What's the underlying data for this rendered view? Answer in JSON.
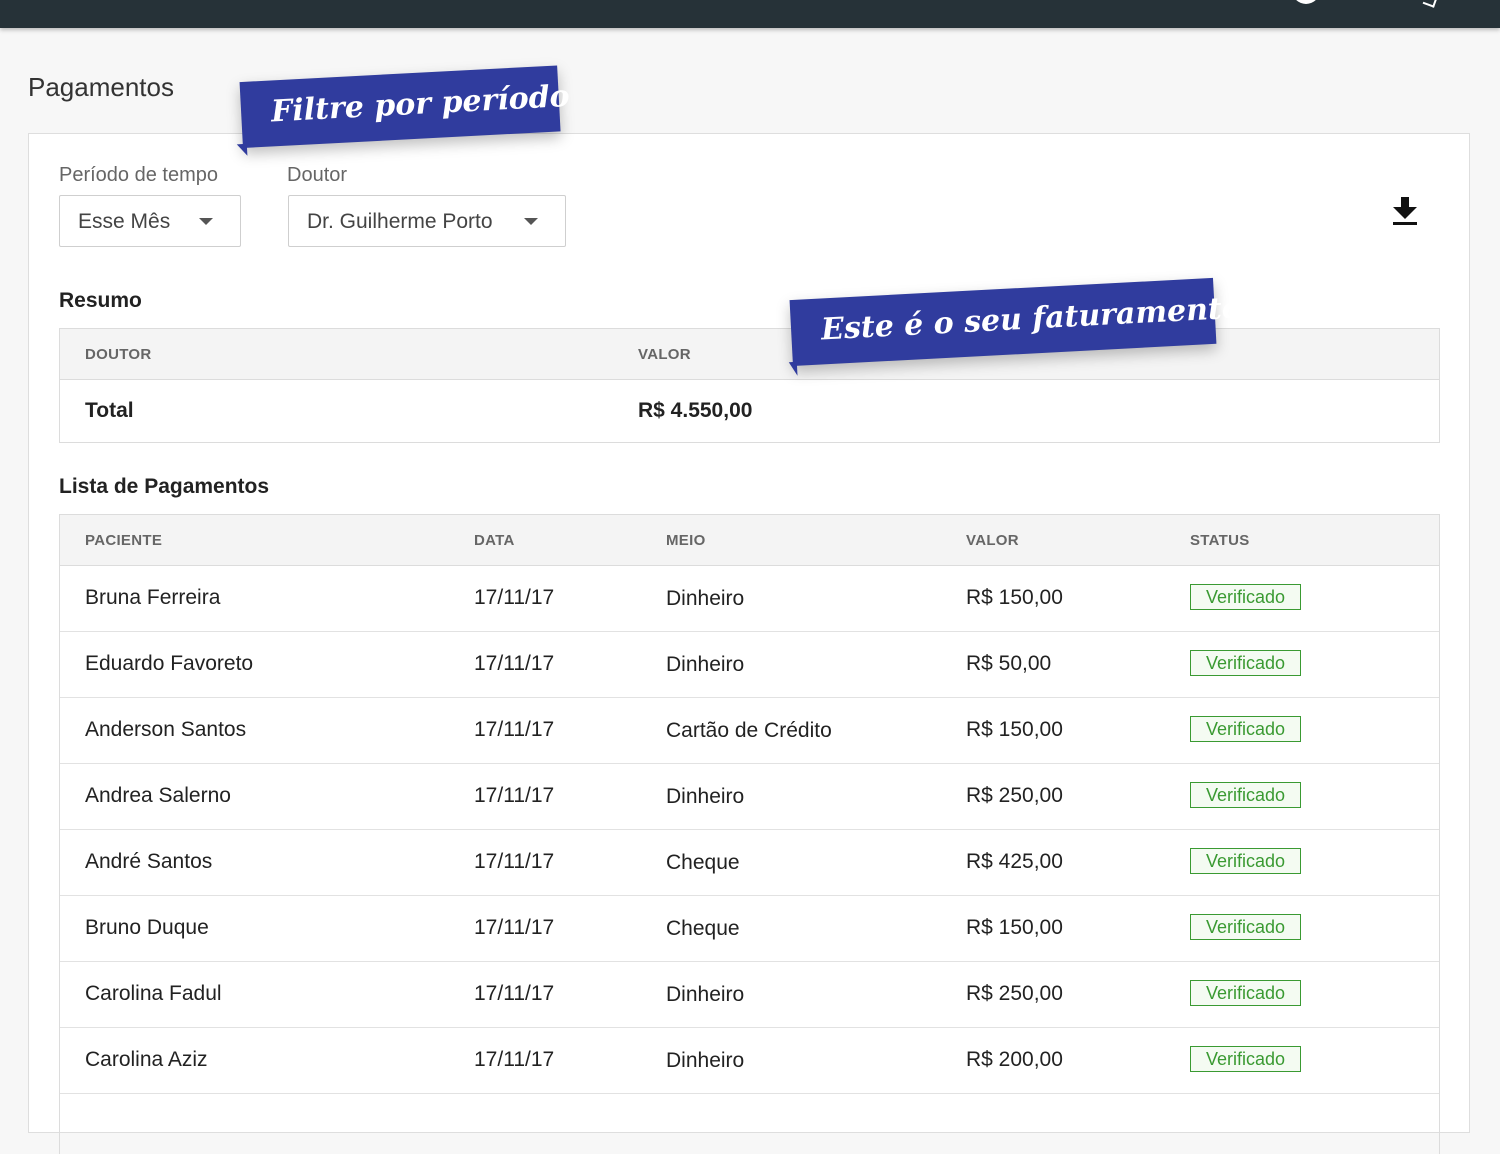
{
  "page": {
    "title": "Pagamentos"
  },
  "filters": {
    "period_label": "Período de tempo",
    "period_value": "Esse Mês",
    "doctor_label": "Doutor",
    "doctor_value": "Dr. Guilherme Porto"
  },
  "icons": {
    "download": "download-icon",
    "dropdown": "chevron-down-icon"
  },
  "callouts": {
    "period": "Filtre por período",
    "revenue": "Este é o seu faturamento"
  },
  "summary": {
    "title": "Resumo",
    "headers": {
      "doctor": "DOUTOR",
      "value": "VALOR"
    },
    "total_label": "Total",
    "total_value": "R$ 4.550,00"
  },
  "payments": {
    "title": "Lista de Pagamentos",
    "headers": {
      "patient": "PACIENTE",
      "date": "DATA",
      "method": "MEIO",
      "value": "VALOR",
      "status": "STATUS"
    },
    "rows": [
      {
        "patient": "Bruna Ferreira",
        "date": "17/11/17",
        "method": "Dinheiro",
        "value": "R$ 150,00",
        "status": "Verificado"
      },
      {
        "patient": "Eduardo Favoreto",
        "date": "17/11/17",
        "method": "Dinheiro",
        "value": "R$ 50,00",
        "status": "Verificado"
      },
      {
        "patient": "Anderson Santos",
        "date": "17/11/17",
        "method": "Cartão de Crédito",
        "value": "R$ 150,00",
        "status": "Verificado"
      },
      {
        "patient": "Andrea Salerno",
        "date": "17/11/17",
        "method": "Dinheiro",
        "value": "R$ 250,00",
        "status": "Verificado"
      },
      {
        "patient": "André Santos",
        "date": "17/11/17",
        "method": "Cheque",
        "value": "R$ 425,00",
        "status": "Verificado"
      },
      {
        "patient": "Bruno Duque",
        "date": "17/11/17",
        "method": "Cheque",
        "value": "R$ 150,00",
        "status": "Verificado"
      },
      {
        "patient": "Carolina Fadul",
        "date": "17/11/17",
        "method": "Dinheiro",
        "value": "R$ 250,00",
        "status": "Verificado"
      },
      {
        "patient": "Carolina Aziz",
        "date": "17/11/17",
        "method": "Dinheiro",
        "value": "R$ 200,00",
        "status": "Verificado"
      }
    ]
  },
  "colors": {
    "topbar": "#263238",
    "callout": "#303c9e",
    "status_green": "#3a9a32"
  }
}
